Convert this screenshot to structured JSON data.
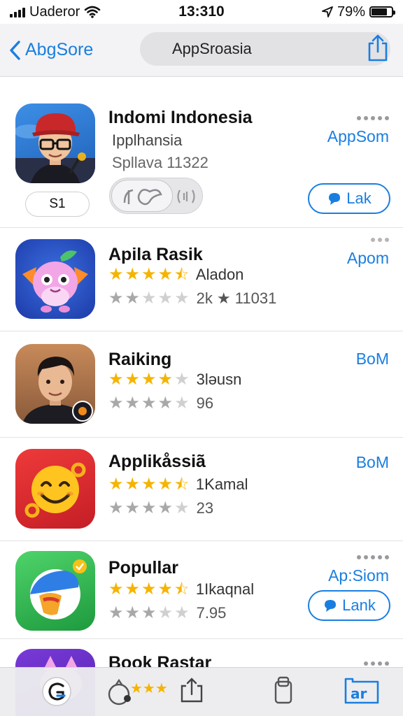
{
  "status_bar": {
    "carrier": "Uaderor",
    "time": "13:310",
    "battery": "79%",
    "battery_level": 0.79
  },
  "nav": {
    "back_label": "AbgSore",
    "search_text": "AppSroasia",
    "share_icon": "share-icon"
  },
  "apps": [
    {
      "name": "Indomi Indonesia",
      "line1": "Ipplhansia",
      "line2": "Spllava 11322",
      "action": "AppSom",
      "badge": "S1",
      "button": "Lak"
    },
    {
      "name": "Apila Rasik",
      "rating_text": "Aladon",
      "rating": 4.5,
      "reviews_text": "2k ★ 11031",
      "reviews_rating": 2,
      "action": "Apom"
    },
    {
      "name": "Raiking",
      "rating_text": "3ləusn",
      "rating": 4,
      "reviews_text": "96",
      "reviews_rating": 4,
      "action": "BoM"
    },
    {
      "name": "Applikåssiã",
      "rating_text": "1Kamal",
      "rating": 4.5,
      "reviews_text": "23",
      "reviews_rating": 4,
      "action": "BoM"
    },
    {
      "name": "Popullar",
      "rating_text": "1Ikaqnal",
      "rating": 4.5,
      "reviews_text": "7.95",
      "reviews_rating": 3,
      "action": "Ap:Siom",
      "button": "Lank"
    },
    {
      "name": "Book Rastar"
    }
  ],
  "tab_bar": {
    "tabs": [
      "today-icon",
      "games-icon",
      "apps-icon",
      "arcade-icon",
      "search-icon"
    ]
  },
  "colors": {
    "accent": "#1a7ee0",
    "star": "#f5b400",
    "nav_bg": "#f3f3f5"
  }
}
